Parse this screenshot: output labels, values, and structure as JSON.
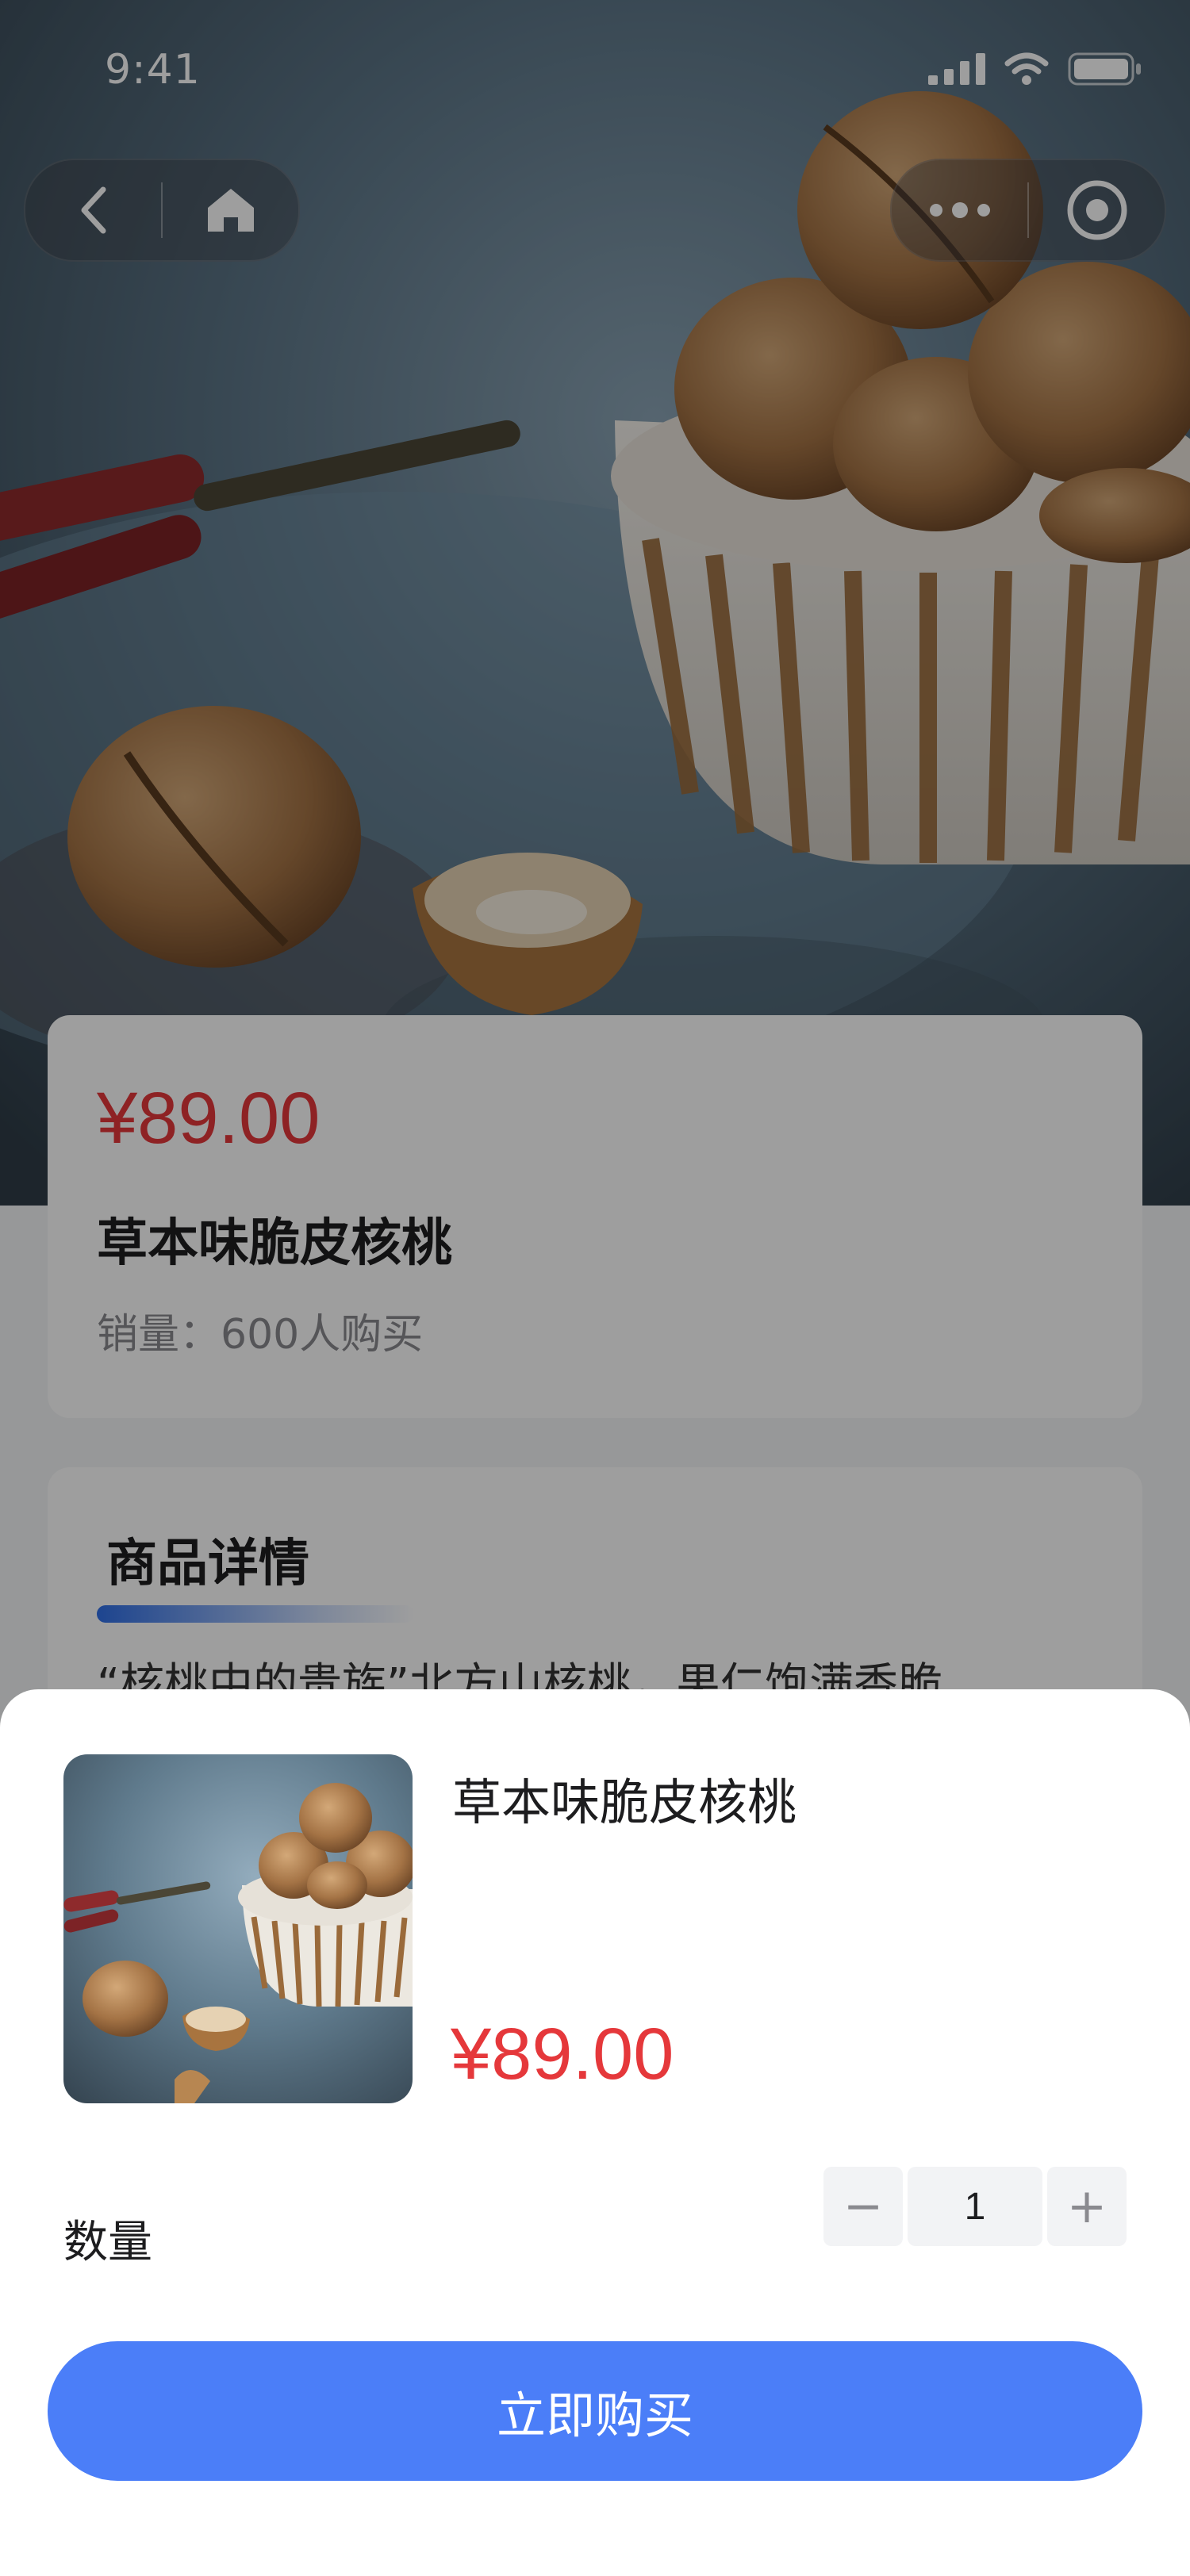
{
  "status_bar": {
    "time": "9:41"
  },
  "nav": {
    "back_icon": "chevron-left-icon",
    "home_icon": "home-icon",
    "more_icon": "more-dots-icon",
    "close_icon": "target-circle-icon"
  },
  "product": {
    "price": "¥89.00",
    "name": "草本味脆皮核桃",
    "sales": "销量：600人购买"
  },
  "detail": {
    "title": "商品详情",
    "text": "“核桃中的贵族”北方山核桃，果仁饱满香脆"
  },
  "sheet": {
    "name": "草本味脆皮核桃",
    "price": "¥89.00",
    "quantity_label": "数量",
    "decrement": "−",
    "quantity": "1",
    "increment": "+",
    "buy_label": "立即购买"
  },
  "colors": {
    "accent": "#4b7ef8",
    "price": "#e5383b"
  }
}
